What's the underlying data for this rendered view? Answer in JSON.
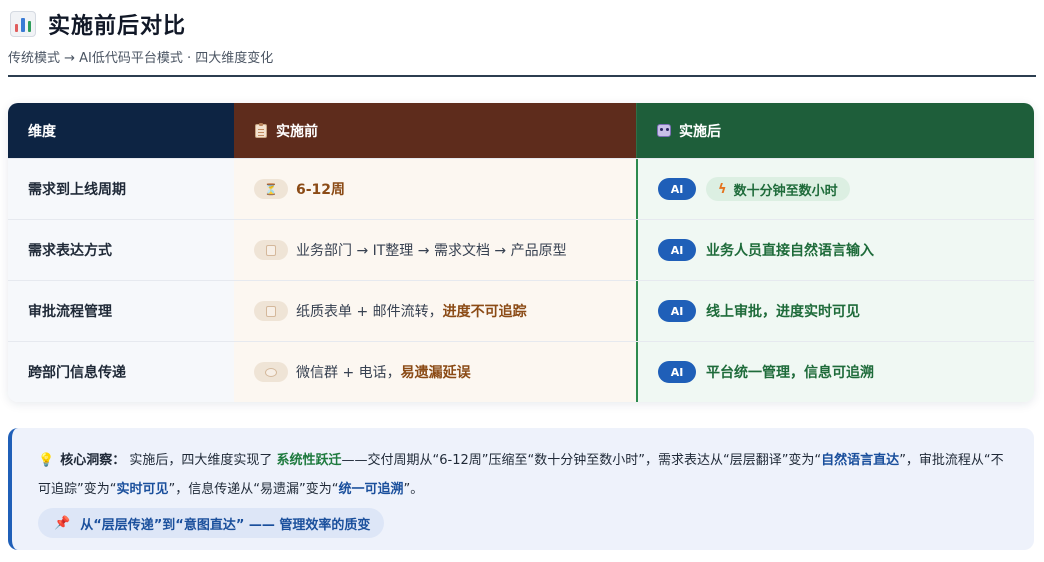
{
  "header": {
    "title": "实施前后对比",
    "subtitle": "传统模式 → AI低代码平台模式 · 四大维度变化"
  },
  "table": {
    "columns": {
      "dimension": "维度",
      "before": "实施前",
      "after": "实施后"
    },
    "rows": [
      {
        "dimension": "需求到上线周期",
        "before_icon": "hourglass-icon",
        "before_text": "",
        "before_highlight": "6-12周",
        "after_badge": "AI",
        "after_text": "数十分钟至数小时",
        "after_icon": "lightning-icon"
      },
      {
        "dimension": "需求表达方式",
        "before_icon": "document-icon",
        "before_text": "业务部门 → IT整理 → 需求文档 → 产品原型",
        "before_highlight": "",
        "after_badge": "AI",
        "after_text": "业务人员直接自然语言输入"
      },
      {
        "dimension": "审批流程管理",
        "before_icon": "clipboard-icon",
        "before_text": "纸质表单 + 邮件流转，",
        "before_highlight": "进度不可追踪",
        "after_badge": "AI",
        "after_text": "线上审批，进度实时可见"
      },
      {
        "dimension": "跨部门信息传递",
        "before_icon": "chat-bubble-icon",
        "before_text": "微信群 + 电话，",
        "before_highlight": "易遗漏延误",
        "after_badge": "AI",
        "after_text": "平台统一管理，信息可追溯"
      }
    ]
  },
  "insight": {
    "label": "核心洞察：",
    "t1": "实施后，四大维度实现了",
    "h1": "系统性跃迁",
    "t2": "——交付周期从“6-12周”压缩至“数十分钟至数小时”，需求表达从“层层翻译”变为“",
    "h2": "自然语言直达",
    "t3": "”，审批流程从“不可追踪”变为“",
    "h3": "实时可见",
    "t4": "”，信息传递从“易遗漏”变为“",
    "h4": "统一可追溯",
    "t5": "”。",
    "pill": "从“层层传递”到“意图直达” —— 管理效率的质变"
  },
  "colors": {
    "header_dimension": "#0d2443",
    "header_before": "#5e2c1c",
    "header_after": "#1e5e3a",
    "ai_badge": "#1f5fb8",
    "insight_bg": "#eef2fb"
  }
}
